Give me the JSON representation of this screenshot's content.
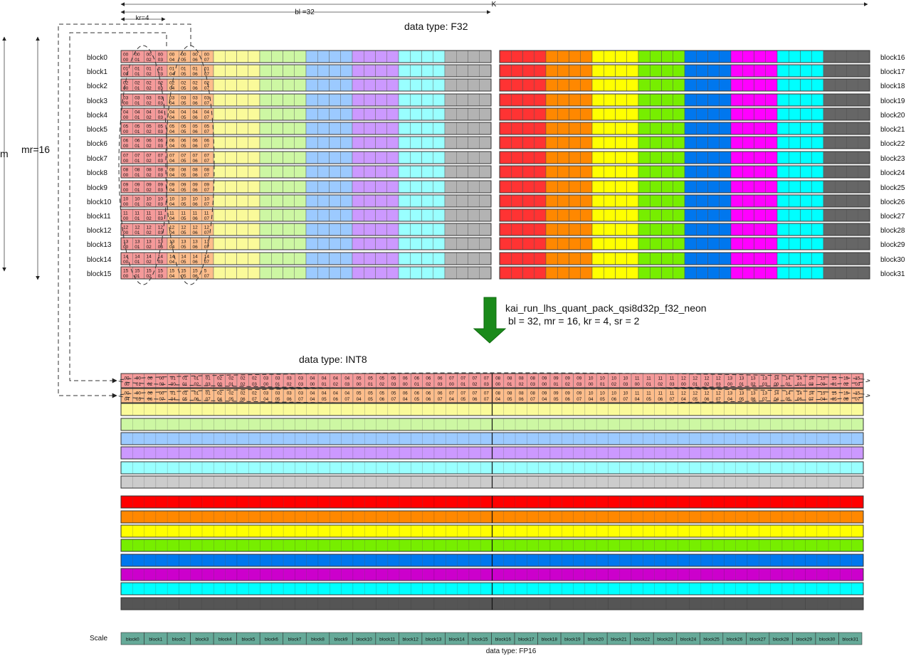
{
  "dims": {
    "K": "K",
    "bl": "bl =32",
    "kr": "kr=4",
    "m": "m",
    "mr": "mr=16"
  },
  "top": {
    "title": "data type: F32",
    "left_blocks": [
      "block0",
      "block1",
      "block2",
      "block3",
      "block4",
      "block5",
      "block6",
      "block7",
      "block8",
      "block9",
      "block10",
      "block11",
      "block12",
      "block13",
      "block14",
      "block15"
    ],
    "right_blocks": [
      "block16",
      "block17",
      "block18",
      "block19",
      "block20",
      "block21",
      "block22",
      "block23",
      "block24",
      "block25",
      "block26",
      "block27",
      "block28",
      "block29",
      "block30",
      "block31"
    ],
    "left_colors": [
      "#f59a9a",
      "#fdbd8b",
      "#fafa9a",
      "#cdf7a3",
      "#9ccaff",
      "#cc99ff",
      "#99ffff",
      "#b3b3b3"
    ],
    "right_colors": [
      "#ff3333",
      "#ff8800",
      "#ffff00",
      "#77ee00",
      "#0077ee",
      "#ff00ff",
      "#00ffff",
      "#666666"
    ],
    "row_numbers": [
      "00",
      "01",
      "02",
      "03",
      "04",
      "05",
      "06",
      "07",
      "08",
      "09",
      "10",
      "11",
      "12",
      "13",
      "14",
      "15"
    ],
    "col_first": [
      "00",
      "01",
      "02",
      "03"
    ],
    "col_second": [
      "04",
      "05",
      "06",
      "07"
    ],
    "last_row_override": "5"
  },
  "op": {
    "name": "kai_run_lhs_quant_pack_qsi8d32p_f32_neon",
    "params": "bl = 32, mr = 16, kr = 4, sr = 2"
  },
  "bottom": {
    "title": "data type: INT8",
    "packed_row1_top": [
      "00",
      "00",
      "00",
      "00",
      "01",
      "01",
      "01",
      "01",
      "02",
      "02",
      "02",
      "02",
      "03",
      "03",
      "03",
      "03",
      "04",
      "04",
      "04",
      "04",
      "05",
      "05",
      "05",
      "05",
      "06",
      "06",
      "06",
      "06",
      "07",
      "07",
      "07",
      "07",
      "08",
      "08",
      "08",
      "08",
      "09",
      "09",
      "09",
      "09",
      "10",
      "10",
      "10",
      "10",
      "11",
      "11",
      "11",
      "11",
      "12",
      "12",
      "12",
      "12",
      "13",
      "13",
      "13",
      "13",
      "14",
      "14",
      "14",
      "14",
      "15",
      "15",
      "15",
      "15"
    ],
    "packed_row1_bottom": [
      "00",
      "01",
      "02",
      "03",
      "00",
      "01",
      "02",
      "03",
      "00",
      "01",
      "02",
      "03",
      "00",
      "01",
      "02",
      "03",
      "00",
      "01",
      "02",
      "03",
      "00",
      "01",
      "02",
      "03",
      "00",
      "01",
      "02",
      "03",
      "00",
      "01",
      "02",
      "03",
      "00",
      "01",
      "02",
      "03",
      "00",
      "01",
      "02",
      "03",
      "00",
      "01",
      "02",
      "03",
      "00",
      "01",
      "02",
      "03",
      "00",
      "01",
      "02",
      "03",
      "00",
      "01",
      "02",
      "03",
      "00",
      "01",
      "02",
      "03",
      "00",
      "01",
      "02",
      "03"
    ],
    "packed_row2_top": [
      "00",
      "00",
      "00",
      "00",
      "01",
      "01",
      "01",
      "01",
      "02",
      "02",
      "02",
      "02",
      "03",
      "03",
      "03",
      "03",
      "04",
      "04",
      "04",
      "04",
      "05",
      "05",
      "05",
      "05",
      "06",
      "06",
      "06",
      "06",
      "07",
      "07",
      "07",
      "07",
      "08",
      "08",
      "08",
      "08",
      "09",
      "09",
      "09",
      "09",
      "10",
      "10",
      "10",
      "10",
      "11",
      "11",
      "11",
      "11",
      "12",
      "12",
      "12",
      "12",
      "13",
      "13",
      "13",
      "13",
      "14",
      "14",
      "14",
      "14",
      "15",
      "15",
      "15",
      "15"
    ],
    "packed_row2_bottom": [
      "04",
      "05",
      "06",
      "07",
      "04",
      "05",
      "06",
      "07",
      "04",
      "05",
      "06",
      "07",
      "04",
      "05",
      "06",
      "07",
      "04",
      "05",
      "06",
      "07",
      "04",
      "05",
      "06",
      "07",
      "04",
      "05",
      "06",
      "07",
      "04",
      "05",
      "06",
      "07",
      "04",
      "05",
      "06",
      "07",
      "04",
      "05",
      "06",
      "07",
      "04",
      "05",
      "06",
      "07",
      "04",
      "05",
      "06",
      "07",
      "04",
      "05",
      "06",
      "07",
      "04",
      "05",
      "06",
      "07",
      "04",
      "05",
      "06",
      "07",
      "04",
      "05",
      "06",
      "07"
    ],
    "row1_color": "#f59a9a",
    "row2_color": "#fdbd8b",
    "light_colors": [
      "#fafa9a",
      "#cdf7a3",
      "#9ccaff",
      "#cc99ff",
      "#99ffff",
      "#cccccc"
    ],
    "bright_colors": [
      "#ff0000",
      "#ff8800",
      "#ffff00",
      "#77ee00",
      "#0077ee",
      "#cc00cc",
      "#00ffff",
      "#555555"
    ]
  },
  "scale": {
    "label": "Scale",
    "type_label": "data type: FP16",
    "color": "#66aa99",
    "blocks": [
      "block0",
      "block1",
      "block2",
      "block3",
      "block4",
      "block5",
      "block6",
      "block7",
      "block8",
      "block9",
      "block10",
      "block11",
      "block12",
      "block13",
      "block14",
      "block15",
      "block16",
      "block17",
      "block18",
      "block19",
      "block20",
      "block21",
      "block22",
      "block23",
      "block24",
      "block25",
      "block26",
      "block27",
      "block28",
      "block29",
      "block30",
      "block31"
    ]
  }
}
